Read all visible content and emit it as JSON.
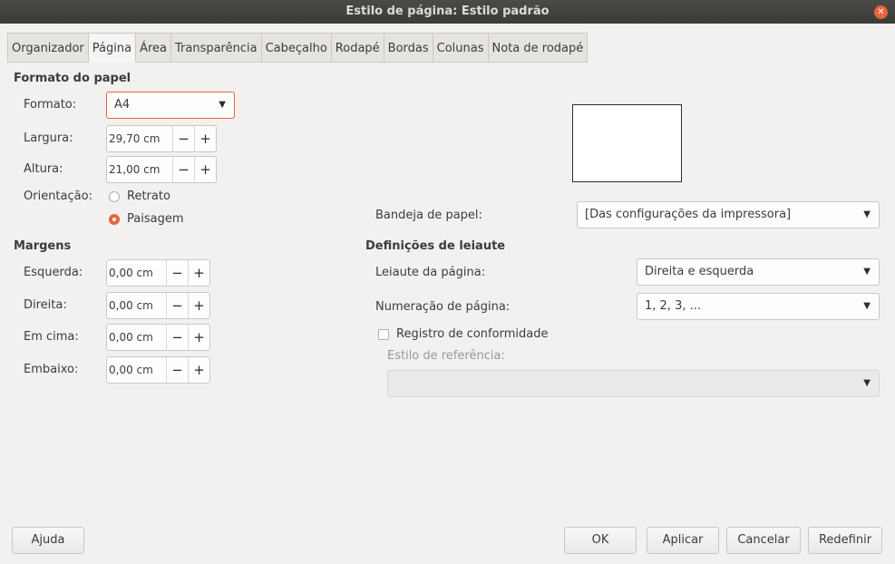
{
  "window": {
    "title": "Estilo de página: Estilo padrão",
    "close_icon": "close-icon"
  },
  "tabs": [
    {
      "label": "Organizador",
      "active": false
    },
    {
      "label": "Página",
      "active": true
    },
    {
      "label": "Área",
      "active": false
    },
    {
      "label": "Transparência",
      "active": false
    },
    {
      "label": "Cabeçalho",
      "active": false
    },
    {
      "label": "Rodapé",
      "active": false
    },
    {
      "label": "Bordas",
      "active": false
    },
    {
      "label": "Colunas",
      "active": false
    },
    {
      "label": "Nota de rodapé",
      "active": false
    }
  ],
  "paper_format": {
    "title": "Formato do papel",
    "format_label": "Formato:",
    "format_value": "A4",
    "width_label": "Largura:",
    "width_value": "29,70 cm",
    "height_label": "Altura:",
    "height_value": "21,00 cm",
    "orientation_label": "Orientação:",
    "portrait_label": "Retrato",
    "landscape_label": "Paisagem",
    "orientation_selected": "Paisagem"
  },
  "margins": {
    "title": "Margens",
    "left_label": "Esquerda:",
    "left_value": "0,00 cm",
    "right_label": "Direita:",
    "right_value": "0,00 cm",
    "top_label": "Em cima:",
    "top_value": "0,00 cm",
    "bottom_label": "Embaixo:",
    "bottom_value": "0,00 cm"
  },
  "paper_tray": {
    "label": "Bandeja de papel:",
    "value": "[Das configurações da impressora]"
  },
  "layout_settings": {
    "title": "Definições de leiaute",
    "page_layout_label": "Leiaute da página:",
    "page_layout_value": "Direita e esquerda",
    "page_numbering_label": "Numeração de página:",
    "page_numbering_value": "1, 2, 3, ...",
    "register_true_label": "Registro de conformidade",
    "register_true_checked": false,
    "reference_style_label": "Estilo de referência:",
    "reference_style_value": ""
  },
  "spin": {
    "minus": "−",
    "plus": "+"
  },
  "footer": {
    "help": "Ajuda",
    "ok": "OK",
    "apply": "Aplicar",
    "cancel": "Cancelar",
    "reset": "Redefinir"
  }
}
